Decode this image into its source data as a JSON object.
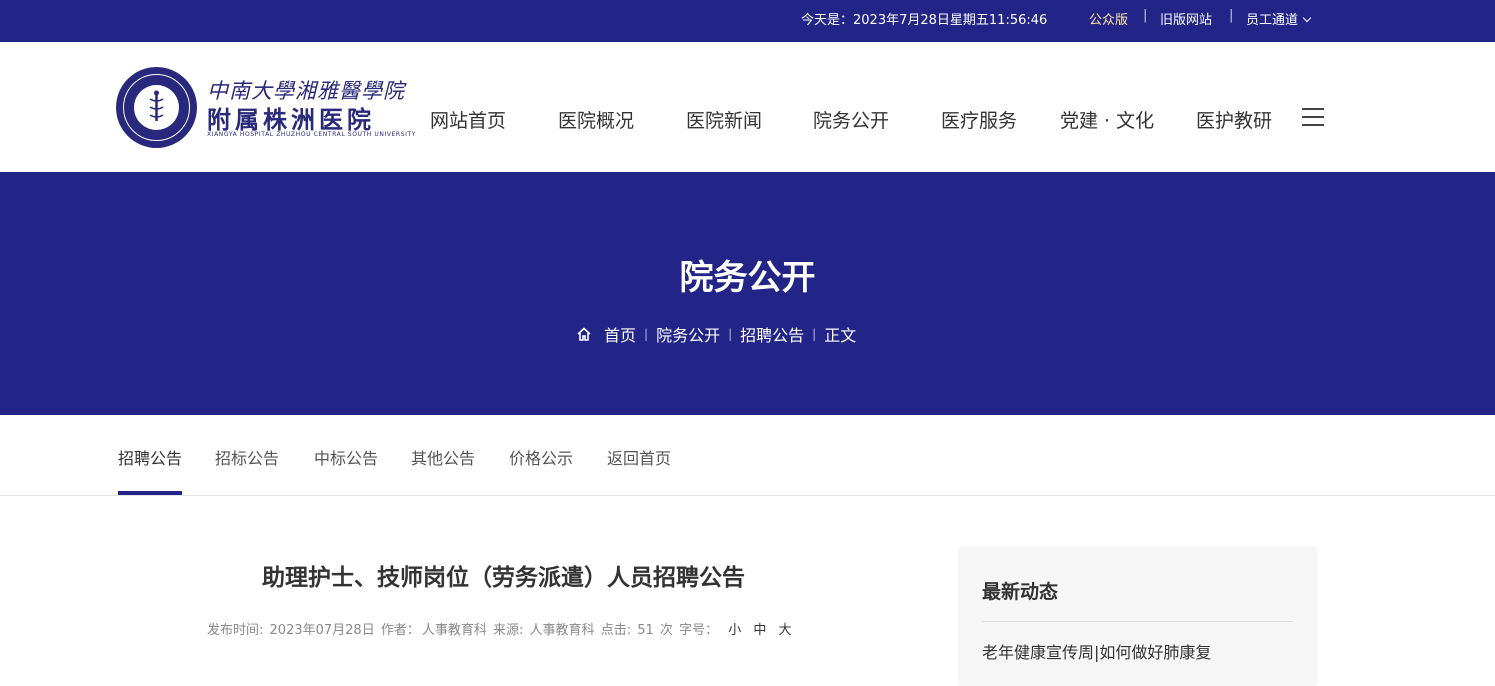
{
  "topbar": {
    "date": "今天是：2023年7月28日星期五11:56:46",
    "public_version": "公众版",
    "old_site": "旧版网站",
    "staff_portal": "员工通道",
    "separator": "|",
    "public_version_color": "#ffe9a6"
  },
  "logo": {
    "line1": "中南大學湘雅醫學院",
    "line2": "附属株洲医院",
    "line3": "XIANGYA HOSPITAL ZHUZHOU CENTRAL SOUTH UNIVERSITY"
  },
  "nav": {
    "items": [
      "网站首页",
      "医院概况",
      "医院新闻",
      "院务公开",
      "医疗服务",
      "党建 · 文化",
      "医护教研"
    ]
  },
  "banner": {
    "title": "院务公开",
    "breadcrumb": [
      "首页",
      "院务公开",
      "招聘公告",
      "正文"
    ],
    "separator": "|"
  },
  "subnav": {
    "items": [
      "招聘公告",
      "招标公告",
      "中标公告",
      "其他公告",
      "价格公示",
      "返回首页"
    ],
    "active_index": 0
  },
  "article": {
    "title": "助理护士、技师岗位（劳务派遣）人员招聘公告",
    "meta": {
      "publish_label": "发布时间:",
      "publish_date": "2023年07月28日",
      "author_label": "作者：",
      "author": "人事教育科",
      "source_label": "来源:",
      "source": "人事教育科",
      "clicks_label": "点击:",
      "clicks": "51",
      "clicks_unit": "次",
      "font_label": "字号：",
      "font_small": "小",
      "font_medium": "中",
      "font_large": "大"
    }
  },
  "sidebar": {
    "heading": "最新动态",
    "items": [
      "老年健康宣传周|如何做好肺康复"
    ]
  },
  "colors": {
    "brand": "#232488",
    "text": "#333333",
    "meta": "#888888",
    "sidebar_bg": "#f6f6f6"
  },
  "icons": {
    "home": "home-icon",
    "menu": "hamburger-menu-icon",
    "dropdown": "chevron-down-icon"
  }
}
